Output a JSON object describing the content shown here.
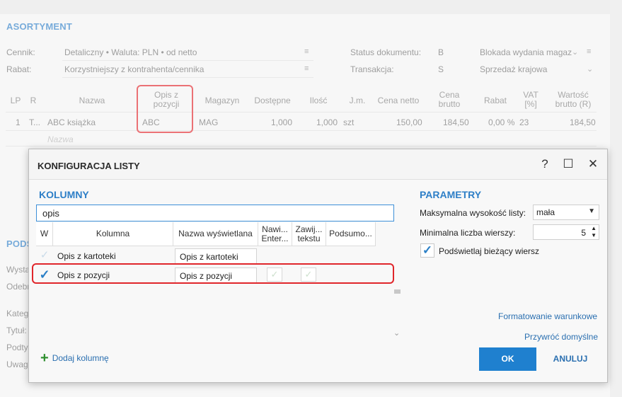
{
  "background": {
    "section_asortyment": "ASORTYMENT",
    "cennik_label": "Cennik:",
    "cennik_value": "Detaliczny • Waluta: PLN • od netto",
    "rabat_label": "Rabat:",
    "rabat_value": "Korzystniejszy z kontrahenta/cennika",
    "status_label": "Status dokumentu:",
    "status_code": "B",
    "status_value": "Blokada wydania magaz",
    "transakcja_label": "Transakcja:",
    "transakcja_code": "S",
    "transakcja_value": "Sprzedaż krajowa",
    "grid_headers": [
      "LP",
      "R",
      "Nazwa",
      "Opis z pozycji",
      "Magazyn",
      "Dostępne",
      "Ilość",
      "J.m.",
      "Cena netto",
      "Cena brutto",
      "Rabat",
      "VAT [%]",
      "Wartość brutto (R)"
    ],
    "row": [
      "1",
      "T...",
      "ABC książka",
      "ABC",
      "MAG",
      "1,000",
      "1,000",
      "szt",
      "150,00",
      "184,50",
      "0,00 %",
      "23",
      "184,50"
    ],
    "name_placeholder": "Nazwa",
    "partial_podsumowanie": "PODS",
    "partial_wystawil": "Wysta",
    "partial_odebral": "Odebr",
    "partial_kategoria": "Kateg",
    "partial_tytul": "Tytuł:",
    "partial_podtyp": "Podty",
    "partial_uwagi": "Uwag"
  },
  "dialog": {
    "title": "KONFIGURACJA LISTY",
    "help": "?",
    "maximize": "☐",
    "close": "✕",
    "kolumny_title": "KOLUMNY",
    "search_value": "opis",
    "columns_headers": [
      "W",
      "Kolumna",
      "Nazwa wyświetlana",
      "Nawi... Enter...",
      "Zawij... tekstu",
      "Podsumo..."
    ],
    "rows": [
      {
        "checked": false,
        "kolumna": "Opis z kartoteki",
        "nazwa": "Opis z kartoteki"
      },
      {
        "checked": true,
        "kolumna": "Opis z pozycji",
        "nazwa": "Opis z pozycji"
      }
    ],
    "add_column": "Dodaj kolumnę",
    "parametry_title": "PARAMETRY",
    "max_height_label": "Maksymalna wysokość listy:",
    "max_height_value": "mała",
    "min_rows_label": "Minimalna liczba wierszy:",
    "min_rows_value": "5",
    "highlight_label": "Podświetlaj bieżący wiersz",
    "highlight_checked": true,
    "formatting_link": "Formatowanie warunkowe",
    "restore_link": "Przywróć domyślne",
    "ok_label": "OK",
    "cancel_label": "ANULUJ",
    "accent_color": "#2e7fc7",
    "highlight_color": "#e0262b"
  }
}
